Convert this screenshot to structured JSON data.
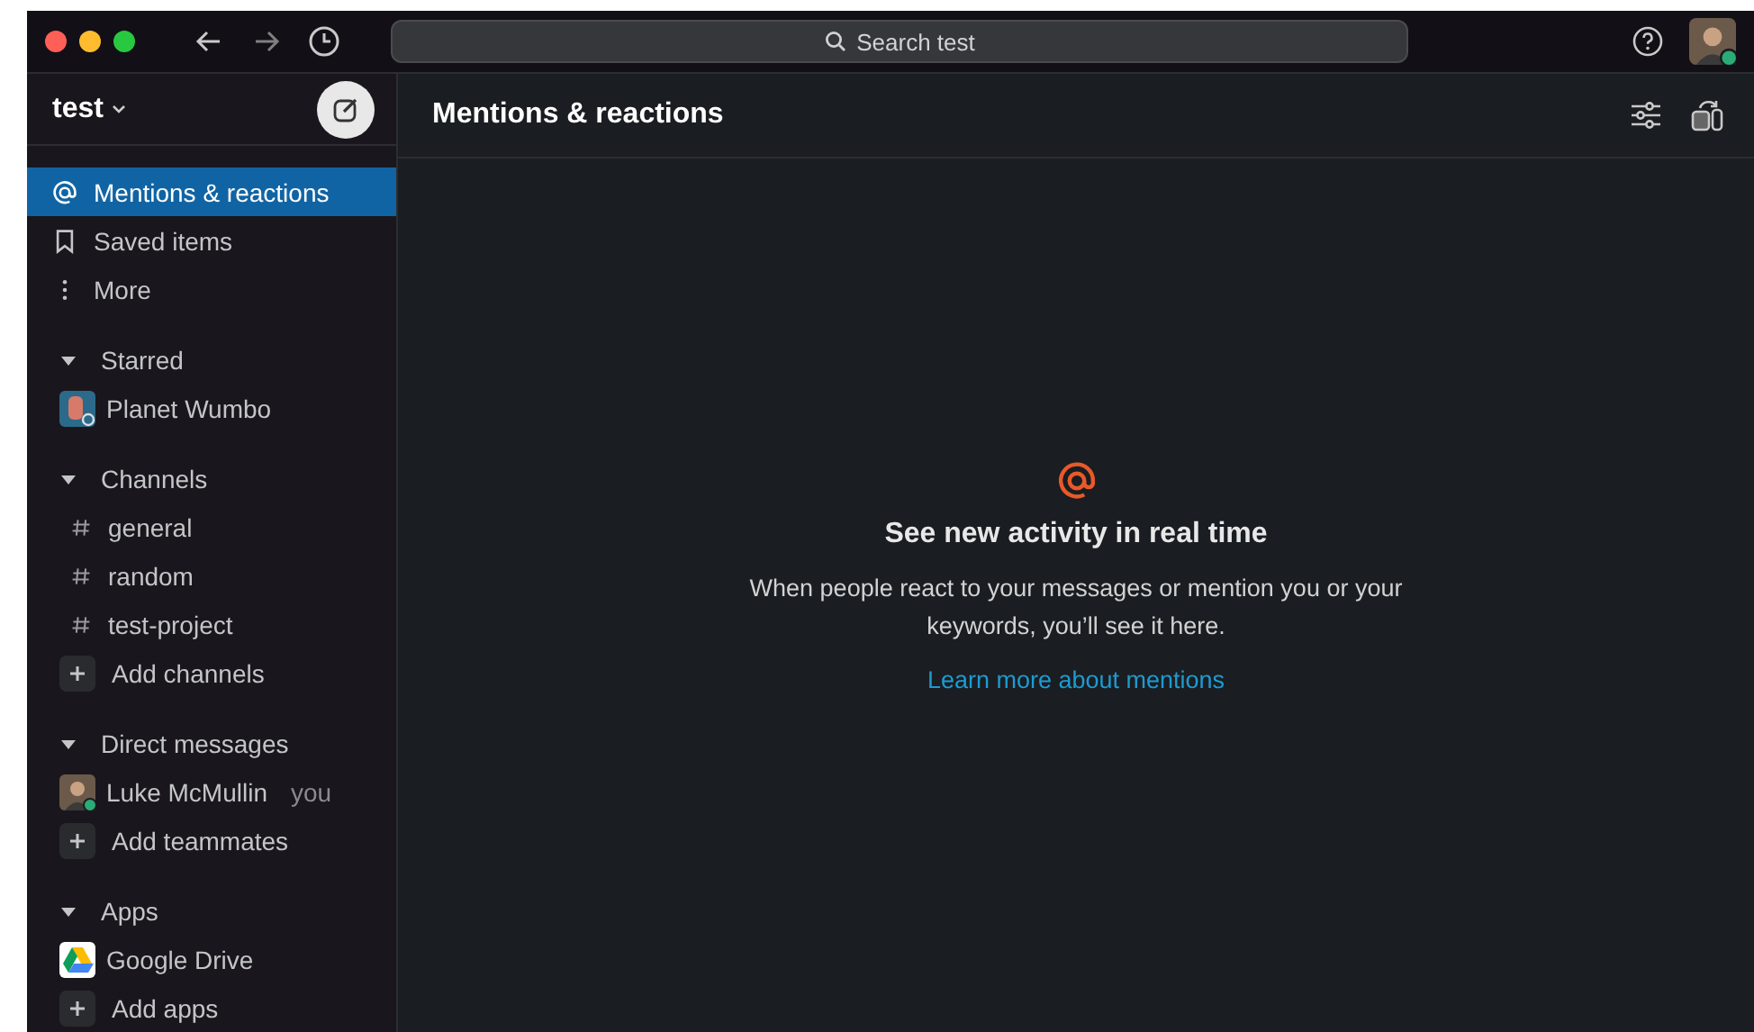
{
  "titlebar": {
    "search": {
      "placeholder": "Search test"
    }
  },
  "sidebar": {
    "workspace": "test",
    "nav": [
      {
        "kind": "at",
        "label": "Mentions & reactions",
        "selected": true
      },
      {
        "kind": "bookmark",
        "label": "Saved items",
        "selected": false
      },
      {
        "kind": "more",
        "label": "More",
        "selected": false
      }
    ],
    "sections": [
      {
        "title": "Starred",
        "expanded": true,
        "items": [
          {
            "kind": "group",
            "label": "Planet Wumbo"
          }
        ]
      },
      {
        "title": "Channels",
        "expanded": true,
        "items": [
          {
            "kind": "channel",
            "label": "general"
          },
          {
            "kind": "channel",
            "label": "random"
          },
          {
            "kind": "channel",
            "label": "test-project"
          },
          {
            "kind": "add",
            "label": "Add channels"
          }
        ]
      },
      {
        "title": "Direct messages",
        "expanded": true,
        "items": [
          {
            "kind": "person",
            "label": "Luke McMullin",
            "suffix": "you"
          },
          {
            "kind": "add",
            "label": "Add teammates"
          }
        ]
      },
      {
        "title": "Apps",
        "expanded": true,
        "items": [
          {
            "kind": "app",
            "label": "Google Drive"
          },
          {
            "kind": "add",
            "label": "Add apps"
          }
        ]
      }
    ]
  },
  "main": {
    "title": "Mentions & reactions",
    "empty_state": {
      "heading": "See new activity in real time",
      "body": "When people react to your messages or mention you or your keywords, you’ll see it here.",
      "link": "Learn more about mentions"
    }
  }
}
